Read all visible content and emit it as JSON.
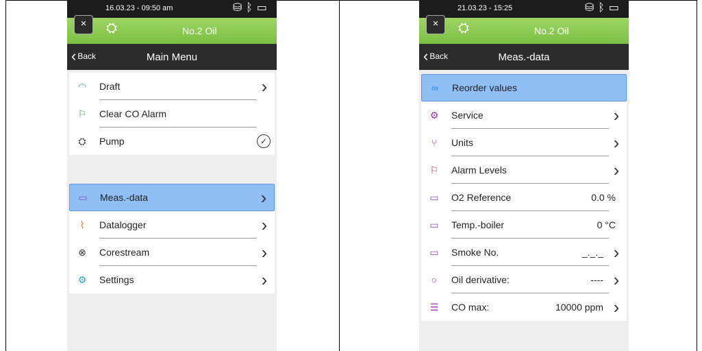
{
  "colors": {
    "green_bar": "#8ac852",
    "selected_row": "#8fbff5",
    "nav_bar": "#2b2b2b"
  },
  "left": {
    "status_time": "16.03.23 - 09:50 am",
    "fuel": "No.2 Oil",
    "back_label": "Back",
    "title": "Main Menu",
    "close_glyph": "×",
    "group1": [
      {
        "icon": "gauge-icon",
        "glyph": "◠",
        "color": "#3aa0d8",
        "label": "Draft",
        "trailing": "arrow"
      },
      {
        "icon": "bell-icon",
        "glyph": "⚐",
        "color": "#2e9e40",
        "label": "Clear CO Alarm",
        "trailing": ""
      },
      {
        "icon": "pump-icon",
        "glyph": "⛭",
        "color": "#333333",
        "label": "Pump",
        "trailing": "check"
      }
    ],
    "group2": [
      {
        "icon": "meas-data-icon",
        "glyph": "▭",
        "color": "#8a4ab8",
        "label": "Meas.-data",
        "trailing": "arrow",
        "selected": true
      },
      {
        "icon": "datalogger-icon",
        "glyph": "⌇",
        "color": "#e07a1e",
        "label": "Datalogger",
        "trailing": "arrow"
      },
      {
        "icon": "corestream-icon",
        "glyph": "⊗",
        "color": "#333333",
        "label": "Corestream",
        "trailing": "arrow"
      },
      {
        "icon": "settings-icon",
        "glyph": "⚙",
        "color": "#1fa8c8",
        "label": "Settings",
        "trailing": "arrow"
      }
    ]
  },
  "right": {
    "status_time": "21.03.23 - 15:25",
    "fuel": "No.2 Oil",
    "back_label": "Back",
    "title": "Meas.-data",
    "close_glyph": "×",
    "rows": [
      {
        "icon": "reorder-icon",
        "glyph": "∞",
        "color": "#1f8fe0",
        "label": "Reorder values",
        "value": "",
        "trailing": "",
        "selected": true
      },
      {
        "icon": "service-icon",
        "glyph": "⚙",
        "color": "#9b35b3",
        "label": "Service",
        "value": "",
        "trailing": "arrow"
      },
      {
        "icon": "units-icon",
        "glyph": "⑂",
        "color": "#9b35b3",
        "label": "Units",
        "value": "",
        "trailing": "arrow"
      },
      {
        "icon": "alarm-icon",
        "glyph": "⚐",
        "color": "#d42a2a",
        "label": "Alarm Levels",
        "value": "",
        "trailing": "arrow"
      },
      {
        "icon": "meas-data-icon",
        "glyph": "▭",
        "color": "#8a4ab8",
        "label": "O2 Reference",
        "value": "0.0 %",
        "trailing": ""
      },
      {
        "icon": "meas-data-icon",
        "glyph": "▭",
        "color": "#8a4ab8",
        "label": "Temp.-boiler",
        "value": "0 °C",
        "trailing": ""
      },
      {
        "icon": "meas-data-icon",
        "glyph": "▭",
        "color": "#8a4ab8",
        "label": "Smoke No.",
        "value": "_._._",
        "trailing": "arrow"
      },
      {
        "icon": "oil-derivative-icon",
        "glyph": "○",
        "color": "#9b35b3",
        "label": "Oil derivative:",
        "value": "----",
        "trailing": "arrow"
      },
      {
        "icon": "list-icon",
        "glyph": "☰",
        "color": "#9b35b3",
        "label": "CO max:",
        "value": "10000 ppm",
        "trailing": "arrow"
      }
    ]
  }
}
